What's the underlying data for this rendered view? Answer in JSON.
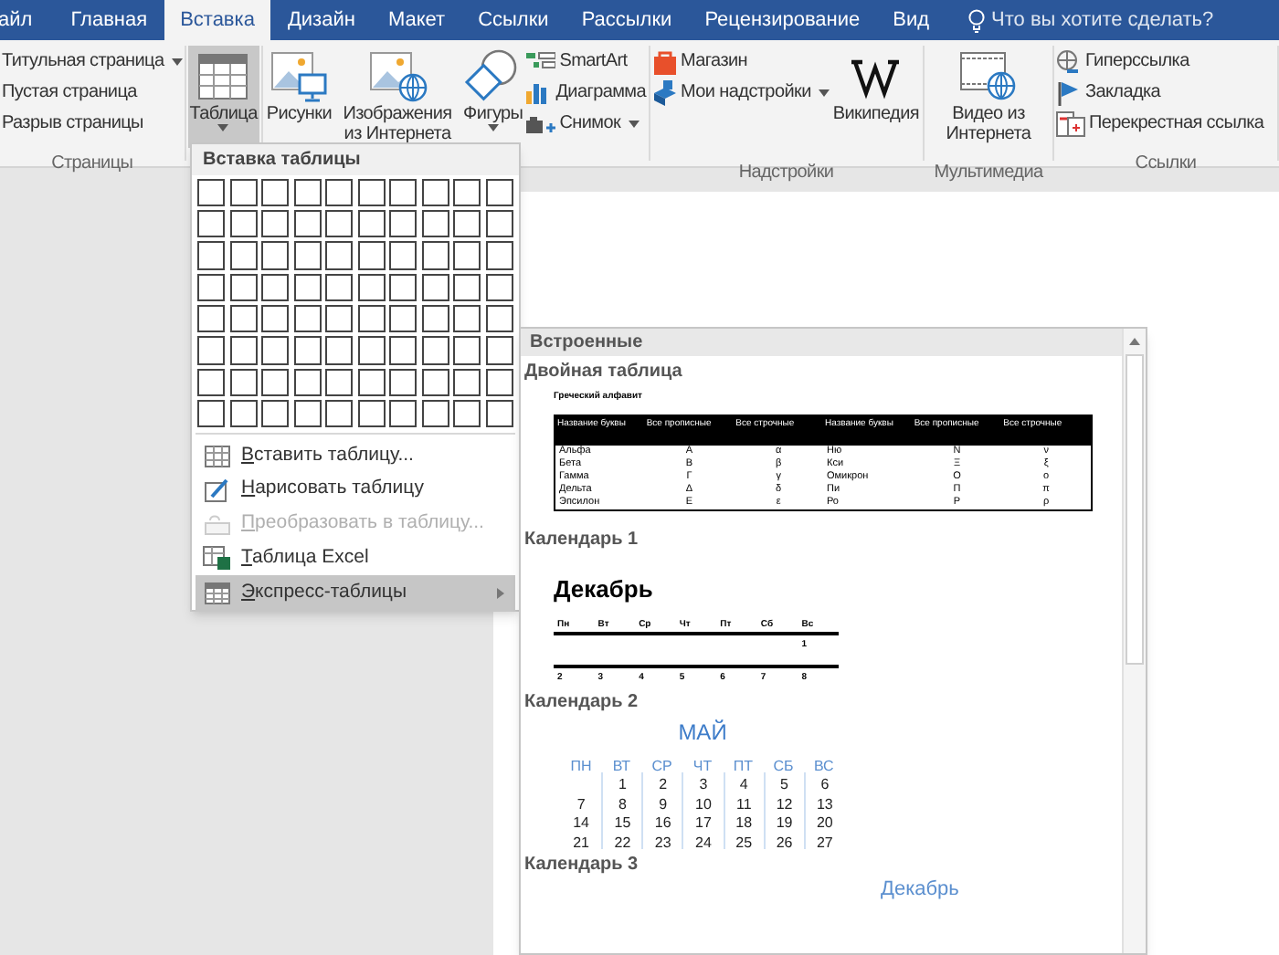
{
  "tabs": [
    {
      "label": "айл",
      "selected": false
    },
    {
      "label": "Главная",
      "selected": false
    },
    {
      "label": "Вставка",
      "selected": true
    },
    {
      "label": "Дизайн",
      "selected": false
    },
    {
      "label": "Макет",
      "selected": false
    },
    {
      "label": "Ссылки",
      "selected": false
    },
    {
      "label": "Рассылки",
      "selected": false
    },
    {
      "label": "Рецензирование",
      "selected": false
    },
    {
      "label": "Вид",
      "selected": false
    }
  ],
  "tell_me": "Что вы хотите сделать?",
  "ribbon": {
    "groups": [
      {
        "label": "Страницы",
        "items": [
          {
            "kind": "small",
            "label": "Титульная страница",
            "dropdown": true
          },
          {
            "kind": "small",
            "label": "Пустая страница"
          },
          {
            "kind": "small",
            "label": "Разрыв страницы"
          }
        ]
      },
      {
        "items": [
          {
            "kind": "large",
            "label": "Таблица",
            "dropdown": true,
            "selected": true
          }
        ]
      },
      {
        "items": [
          {
            "kind": "large",
            "label": "Рисунки"
          },
          {
            "kind": "large",
            "label": "Изображения из Интернета"
          },
          {
            "kind": "large",
            "label": "Фигуры",
            "dropdown": true
          },
          {
            "kind": "small",
            "label": "SmartArt"
          },
          {
            "kind": "small",
            "label": "Диаграмма"
          },
          {
            "kind": "small",
            "label": "Снимок",
            "dropdown": true
          }
        ]
      },
      {
        "label": "Надстройки",
        "items": [
          {
            "kind": "small",
            "label": "Магазин"
          },
          {
            "kind": "small",
            "label": "Мои надстройки",
            "dropdown": true
          },
          {
            "kind": "large",
            "label": "Википедия"
          }
        ]
      },
      {
        "label": "Мультимедиа",
        "items": [
          {
            "kind": "large",
            "label": "Видео из Интернета"
          }
        ]
      },
      {
        "label": "Ссылки",
        "items": [
          {
            "kind": "small",
            "label": "Гиперссылка"
          },
          {
            "kind": "small",
            "label": "Закладка"
          },
          {
            "kind": "small",
            "label": "Перекрестная ссылка"
          }
        ]
      }
    ]
  },
  "table_menu": {
    "title": "Вставка таблицы",
    "items": [
      {
        "label": "Вставить таблицу...",
        "disabled": false,
        "selected": false,
        "submenu": false
      },
      {
        "label": "Нарисовать таблицу",
        "disabled": false,
        "selected": false,
        "submenu": false
      },
      {
        "label": "Преобразовать в таблицу...",
        "disabled": true,
        "selected": false,
        "submenu": false
      },
      {
        "label": "Таблица Excel",
        "disabled": false,
        "selected": false,
        "submenu": false
      },
      {
        "label": "Экспресс-таблицы",
        "disabled": false,
        "selected": true,
        "submenu": true
      }
    ]
  },
  "gallery": {
    "header": "Встроенные",
    "sections": [
      {
        "kind": "greek_table",
        "title": "Двойная таблица",
        "caption": "Греческий алфавит",
        "columns": [
          "Название буквы",
          "Все прописные",
          "Все строчные",
          "Название буквы",
          "Все прописные",
          "Все строчные"
        ],
        "rows": [
          [
            "Альфа",
            "Α",
            "α",
            "Ню",
            "Ν",
            "ν"
          ],
          [
            "Бета",
            "Β",
            "β",
            "Кси",
            "Ξ",
            "ξ"
          ],
          [
            "Гамма",
            "Γ",
            "γ",
            "Омикрон",
            "Ο",
            "ο"
          ],
          [
            "Дельта",
            "Δ",
            "δ",
            "Пи",
            "Π",
            "π"
          ],
          [
            "Эпсилон",
            "Ε",
            "ε",
            "Ро",
            "Ρ",
            "ρ"
          ]
        ]
      },
      {
        "kind": "calendar_lines",
        "title": "Календарь 1",
        "month": "Декабрь",
        "weekdays": [
          "Пн",
          "Вт",
          "Ср",
          "Чт",
          "Пт",
          "Сб",
          "Вс"
        ],
        "weeks": [
          [
            "1"
          ],
          [
            "2",
            "3",
            "4",
            "5",
            "6",
            "7",
            "8"
          ]
        ]
      },
      {
        "kind": "calendar_grid",
        "title": "Календарь 2",
        "month": "МАЙ",
        "weekdays": [
          "ПН",
          "ВТ",
          "СР",
          "ЧТ",
          "ПТ",
          "СБ",
          "ВС"
        ],
        "weeks": [
          [
            "1",
            "2",
            "3",
            "4",
            "5",
            "6"
          ],
          [
            "7",
            "8",
            "9",
            "10",
            "11",
            "12",
            "13"
          ],
          [
            "14",
            "15",
            "16",
            "17",
            "18",
            "19",
            "20"
          ],
          [
            "21",
            "22",
            "23",
            "24",
            "25",
            "26",
            "27"
          ]
        ]
      },
      {
        "kind": "calendar_heading",
        "title": "Календарь 3",
        "month": "Декабрь"
      }
    ]
  }
}
